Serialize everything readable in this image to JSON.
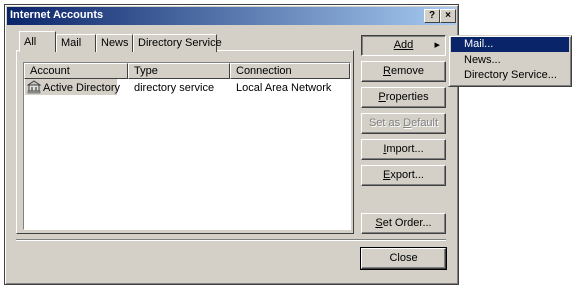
{
  "window": {
    "title": "Internet Accounts",
    "help_glyph": "?",
    "close_glyph": "×"
  },
  "tabs": [
    {
      "label": "All",
      "active": true
    },
    {
      "label": "Mail"
    },
    {
      "label": "News"
    },
    {
      "label": "Directory Service"
    }
  ],
  "list": {
    "columns": [
      "Account",
      "Type",
      "Connection"
    ],
    "rows": [
      {
        "account": "Active Directory",
        "type": "directory service",
        "connection": "Local Area Network",
        "icon": "directory-service-icon"
      }
    ]
  },
  "buttons": {
    "add": "Add",
    "add_arrow": "▸",
    "remove_u": "R",
    "remove_rest": "emove",
    "properties_u": "P",
    "properties_rest": "roperties",
    "set_default_pre": "Set as ",
    "set_default_u": "D",
    "set_default_post": "efault",
    "import_u": "I",
    "import_rest": "mport...",
    "export_u": "E",
    "export_rest": "xport...",
    "set_order_u": "S",
    "set_order_rest": "et Order...",
    "close": "Close"
  },
  "add_menu": {
    "items": [
      {
        "label": "Mail...",
        "selected": true
      },
      {
        "label": "News..."
      },
      {
        "label": "Directory Service..."
      }
    ]
  },
  "colors": {
    "face": "#d4d0c8",
    "title_start": "#0a246a",
    "title_end": "#a6caf0",
    "highlight": "#0a246a"
  }
}
